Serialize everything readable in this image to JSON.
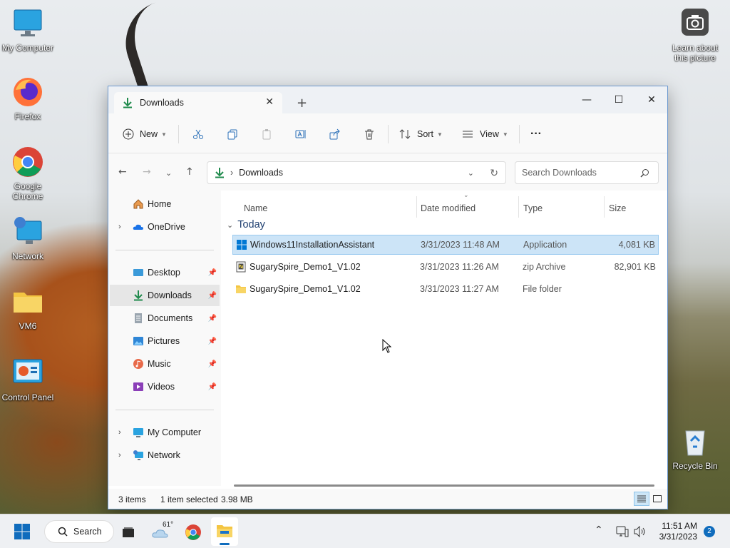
{
  "desktop": {
    "icons": [
      {
        "label": "My Computer"
      },
      {
        "label": "Firefox"
      },
      {
        "label": "Google Chrome"
      },
      {
        "label": "Network"
      },
      {
        "label": "VM6"
      },
      {
        "label": "Control Panel"
      },
      {
        "label": "Learn about this picture"
      },
      {
        "label": "Recycle Bin"
      }
    ]
  },
  "window": {
    "tab_title": "Downloads",
    "tab_close": "✕",
    "new_tab": "+",
    "controls": {
      "minimize": "—",
      "maximize": "☐",
      "close": "✕"
    }
  },
  "toolbar": {
    "new_label": "New",
    "sort_label": "Sort",
    "view_label": "View",
    "more_label": "···"
  },
  "address": {
    "path": "Downloads",
    "search_placeholder": "Search Downloads"
  },
  "nav": {
    "items": [
      {
        "label": "Home"
      },
      {
        "label": "OneDrive"
      },
      {
        "label": "Desktop"
      },
      {
        "label": "Downloads"
      },
      {
        "label": "Documents"
      },
      {
        "label": "Pictures"
      },
      {
        "label": "Music"
      },
      {
        "label": "Videos"
      },
      {
        "label": "My Computer"
      },
      {
        "label": "Network"
      }
    ]
  },
  "files": {
    "columns": {
      "name": "Name",
      "date": "Date modified",
      "type": "Type",
      "size": "Size"
    },
    "group": "Today",
    "rows": [
      {
        "name": "Windows11InstallationAssistant",
        "date": "3/31/2023 11:48 AM",
        "type": "Application",
        "size": "4,081 KB"
      },
      {
        "name": "SugarySpire_Demo1_V1.02",
        "date": "3/31/2023 11:26 AM",
        "type": "zip Archive",
        "size": "82,901 KB"
      },
      {
        "name": "SugarySpire_Demo1_V1.02",
        "date": "3/31/2023 11:27 AM",
        "type": "File folder",
        "size": ""
      }
    ]
  },
  "status": {
    "items": "3 items",
    "selected": "1 item selected",
    "size": "3.98 MB"
  },
  "taskbar": {
    "search_label": "Search",
    "weather": "61°",
    "time": "11:51 AM",
    "date": "3/31/2023",
    "notification_count": "2"
  },
  "colors": {
    "accent": "#0067c0",
    "selection": "#cce4f7",
    "downloads_green": "#1f8a4c",
    "folder_yellow": "#f4c542"
  }
}
